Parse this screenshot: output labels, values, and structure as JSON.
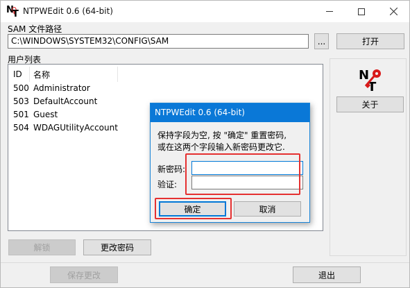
{
  "window": {
    "title": "NTPWEdit 0.6 (64-bit)",
    "app_icon_letters": [
      "N",
      "T"
    ]
  },
  "sam": {
    "label": "SAM 文件路径",
    "path": "C:\\WINDOWS\\SYSTEM32\\CONFIG\\SAM",
    "browse_label": "...",
    "open_label": "打开"
  },
  "users": {
    "group_label": "用户列表",
    "columns": [
      "ID",
      "名称"
    ],
    "rows": [
      {
        "id": "500",
        "name": "Administrator"
      },
      {
        "id": "503",
        "name": "DefaultAccount"
      },
      {
        "id": "501",
        "name": "Guest"
      },
      {
        "id": "504",
        "name": "WDAGUtilityAccount"
      }
    ]
  },
  "right_panel": {
    "about_label": "关于"
  },
  "actions": {
    "unlock_label": "解锁",
    "change_password_label": "更改密码",
    "save_label": "保存更改",
    "exit_label": "退出"
  },
  "dialog": {
    "title": "NTPWEdit 0.6 (64-bit)",
    "message_line1": "保持字段为空, 按 \"确定\" 重置密码,",
    "message_line2": "或在这两个字段输入新密码更改它.",
    "new_password_label": "新密码:",
    "verify_label": "验证:",
    "new_password_value": "",
    "verify_value": "",
    "ok_label": "确定",
    "cancel_label": "取消"
  },
  "colors": {
    "dialog_title_bg": "#0a78d7",
    "highlight": "#e53030",
    "logo_key": "#d81a1a"
  }
}
